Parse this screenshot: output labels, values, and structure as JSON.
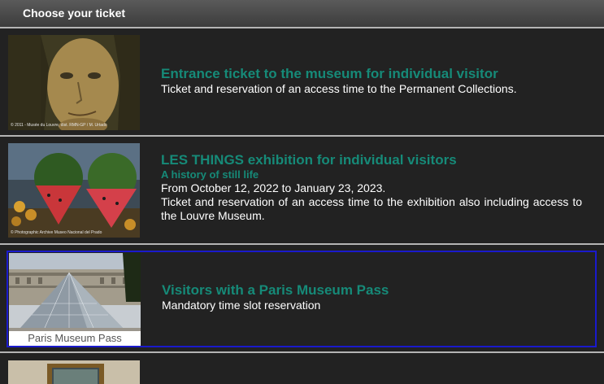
{
  "header": {
    "title": "Choose your ticket"
  },
  "tickets": [
    {
      "title": "Entrance ticket to the museum for individual visitor",
      "description": "Ticket and reservation of an access time to the Permanent Collections.",
      "image_credit": "© 2011 - Musée du Louvre, dist. RMN-GP / M. Urtado",
      "selected": false
    },
    {
      "title": "LES THINGS exhibition for individual visitors",
      "subtitle": "A history of still life",
      "dates": "From October 12, 2022 to January 23, 2023.",
      "description": "Ticket and reservation of an access time to the exhibition also including access to the Louvre Museum.",
      "image_credit": "© Photographic Archive Museo Nacional del Prado",
      "selected": false
    },
    {
      "title": "Visitors with a Paris Museum Pass",
      "description": "Mandatory time slot reservation",
      "image_label": "Paris Museum Pass",
      "selected": true
    }
  ],
  "colors": {
    "background": "#222222",
    "title_green": "#168a78",
    "selection_border": "#1a1acc",
    "separator": "#b4b4b4"
  }
}
